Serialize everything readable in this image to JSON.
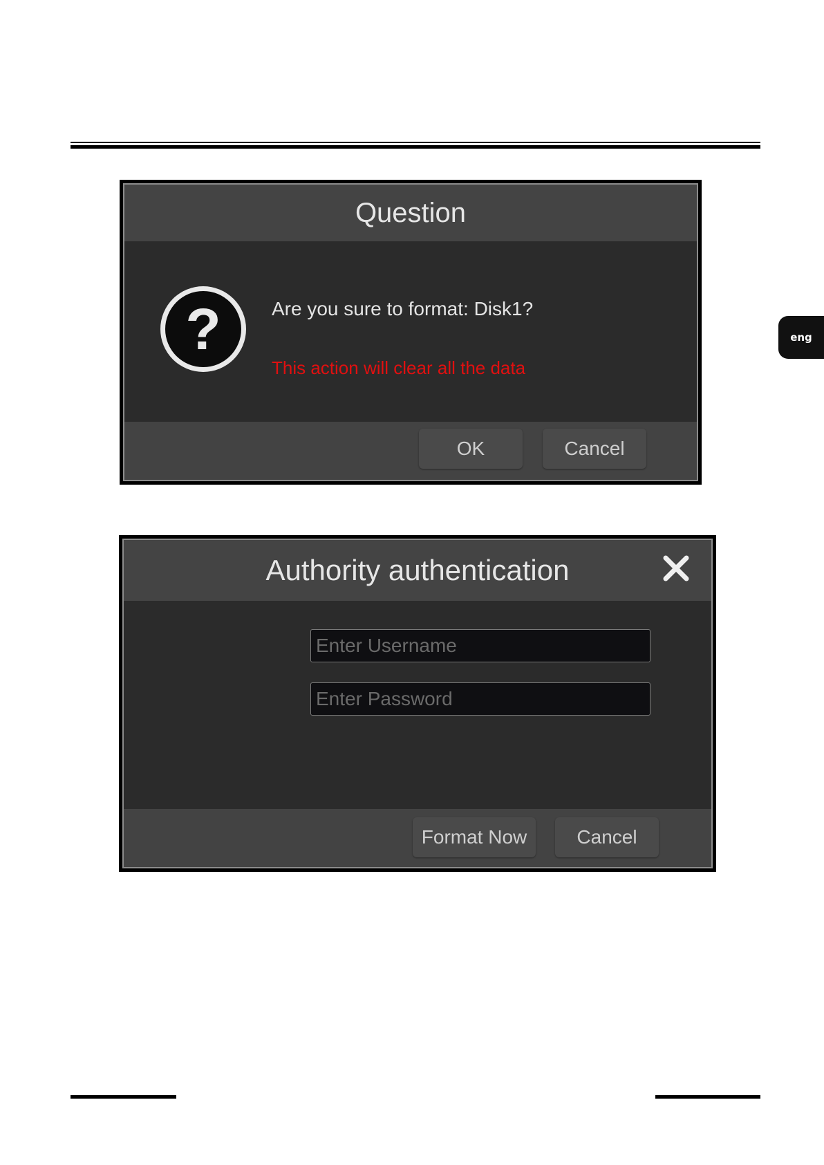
{
  "language_tab": {
    "label": "eng"
  },
  "question_dialog": {
    "title": "Question",
    "message": "Are you sure to format: Disk1?",
    "warning": "This action will clear all the data",
    "warning_color": "#e01010",
    "icon": "question-mark-icon",
    "ok_label": "OK",
    "cancel_label": "Cancel"
  },
  "auth_dialog": {
    "title": "Authority authentication",
    "close_icon": "close-icon",
    "username": {
      "value": "",
      "placeholder": "Enter Username"
    },
    "password": {
      "value": "",
      "placeholder": "Enter Password"
    },
    "format_label": "Format Now",
    "cancel_label": "Cancel"
  }
}
